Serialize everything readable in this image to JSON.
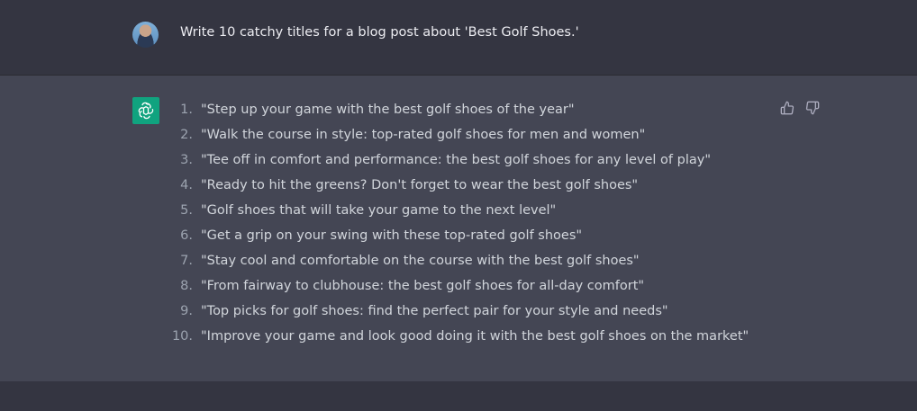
{
  "conversation": {
    "user_message": "Write 10 catchy titles for a blog post about 'Best Golf Shoes.'",
    "assistant_items": [
      {
        "num": "1.",
        "text": "\"Step up your game with the best golf shoes of the year\""
      },
      {
        "num": "2.",
        "text": "\"Walk the course in style: top-rated golf shoes for men and women\""
      },
      {
        "num": "3.",
        "text": "\"Tee off in comfort and performance: the best golf shoes for any level of play\""
      },
      {
        "num": "4.",
        "text": "\"Ready to hit the greens? Don't forget to wear the best golf shoes\""
      },
      {
        "num": "5.",
        "text": "\"Golf shoes that will take your game to the next level\""
      },
      {
        "num": "6.",
        "text": "\"Get a grip on your swing with these top-rated golf shoes\""
      },
      {
        "num": "7.",
        "text": "\"Stay cool and comfortable on the course with the best golf shoes\""
      },
      {
        "num": "8.",
        "text": "\"From fairway to clubhouse: the best golf shoes for all-day comfort\""
      },
      {
        "num": "9.",
        "text": "\"Top picks for golf shoes: find the perfect pair for your style and needs\""
      },
      {
        "num": "10.",
        "text": "\"Improve your game and look good doing it with the best golf shoes on the market\""
      }
    ]
  },
  "icons": {
    "avatar": "user-avatar",
    "assistant": "openai-logo-icon",
    "like": "thumbs-up-icon",
    "dislike": "thumbs-down-icon"
  },
  "colors": {
    "background": "#343541",
    "assistant_background": "#444654",
    "logo_background": "#10a37f",
    "text": "#d1d5db"
  }
}
